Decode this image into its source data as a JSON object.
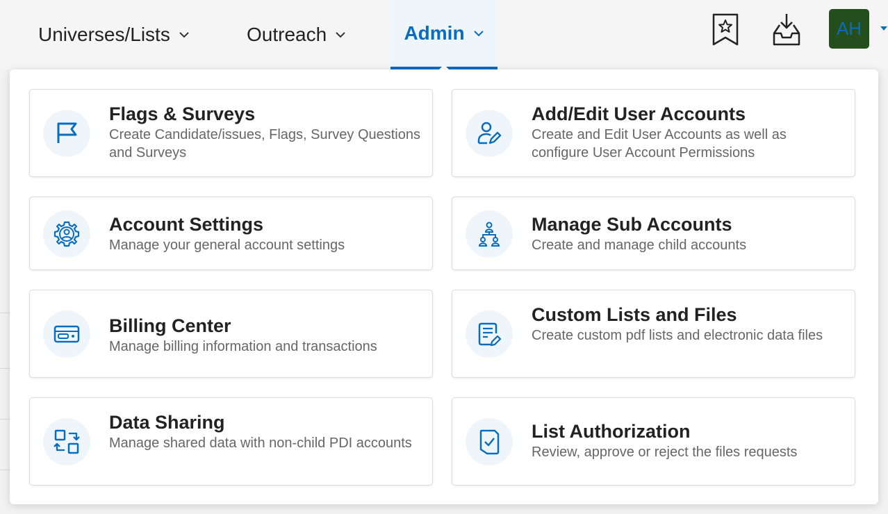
{
  "nav": {
    "items": [
      {
        "label": "Universes/Lists"
      },
      {
        "label": "Outreach"
      },
      {
        "label": "Admin"
      }
    ],
    "avatar_initials": "AH",
    "active_color": "#0a6cbf",
    "avatar_color": "#244f1d"
  },
  "icons": {
    "bookmark": "bookmark-star-icon",
    "download": "download-tray-icon"
  },
  "admin_menu": {
    "cards": [
      {
        "title": "Flags & Surveys",
        "description": "Create Candidate/issues, Flags, Survey Questions and Surveys",
        "icon": "flag-icon"
      },
      {
        "title": "Add/Edit User Accounts",
        "description": "Create and Edit User Accounts as well as configure User Account Permissions",
        "icon": "user-edit-icon"
      },
      {
        "title": "Account Settings",
        "description": "Manage your general account settings",
        "icon": "gear-user-icon"
      },
      {
        "title": "Manage Sub Accounts",
        "description": "Create and manage child accounts",
        "icon": "org-hierarchy-icon"
      },
      {
        "title": "Billing Center",
        "description": "Manage billing information and transactions",
        "icon": "credit-card-icon"
      },
      {
        "title": "Custom Lists and Files",
        "description": "Create custom pdf lists and electronic data files",
        "icon": "document-edit-icon"
      },
      {
        "title": "Data Sharing",
        "description": "Manage shared data with non-child PDI accounts",
        "icon": "share-transfer-icon"
      },
      {
        "title": "List Authorization",
        "description": "Review, approve or reject the files requests",
        "icon": "checklist-icon"
      }
    ]
  }
}
